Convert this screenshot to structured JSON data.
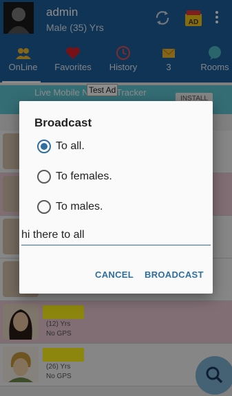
{
  "header": {
    "title": "admin",
    "subtitle": "Male (35) Yrs"
  },
  "icons": {
    "refresh": "refresh-icon",
    "ad": "ad-badge-icon",
    "menu": "overflow-menu-icon"
  },
  "ad_badge_text": "AD",
  "tabs": [
    {
      "label": "OnLine",
      "icon": "people-icon"
    },
    {
      "label": "Favorites",
      "icon": "heart-icon"
    },
    {
      "label": "History",
      "icon": "clock-icon"
    },
    {
      "label": "3",
      "icon": "envelope-icon"
    },
    {
      "label": "Rooms",
      "icon": "chat-bubble-icon"
    }
  ],
  "ad_banner": {
    "text": "Live Mobile Number Tracker",
    "install": "INSTALL",
    "tag": "Test Ad"
  },
  "rows": [
    {
      "age": "(12) Yrs",
      "gps": "No GPS"
    },
    {
      "age": "(26) Yrs",
      "gps": "No GPS"
    }
  ],
  "dialog": {
    "title": "Broadcast",
    "options": [
      {
        "label": "To all.",
        "checked": true
      },
      {
        "label": "To females.",
        "checked": false
      },
      {
        "label": "To males.",
        "checked": false
      }
    ],
    "message_value": "hi there to all",
    "cancel_label": "CANCEL",
    "broadcast_label": "BROADCAST"
  },
  "colors": {
    "accent": "#2f6ea0",
    "header": "#1e5f9b",
    "highlight": "#fff51a",
    "pink_row": "#ecc9d6"
  }
}
